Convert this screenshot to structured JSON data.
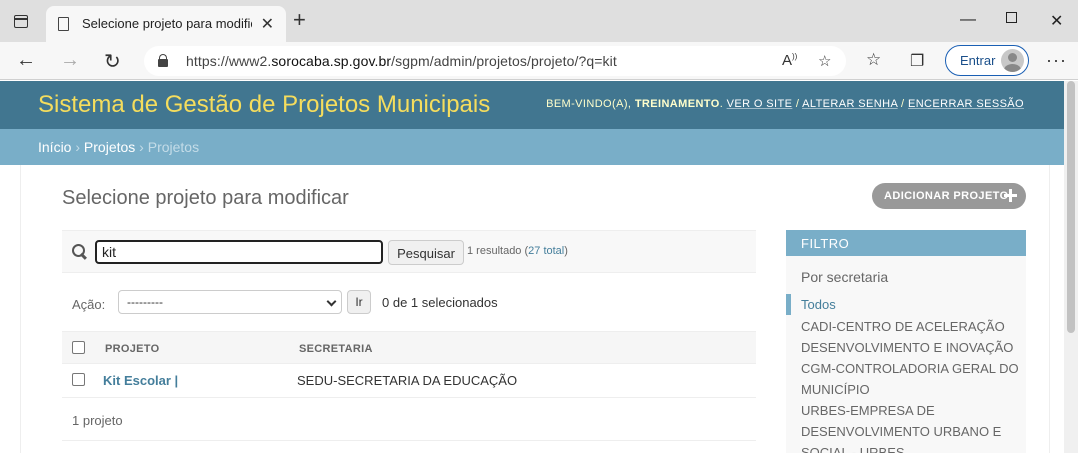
{
  "browser": {
    "tab_title": "Selecione projeto para modificar",
    "url_prefix": "https://www2.",
    "url_host": "sorocaba.sp.gov.br",
    "url_path": "/sgpm/admin/projetos/projeto/?q=kit",
    "signin_label": "Entrar"
  },
  "header": {
    "site_name": "Sistema de Gestão de Projetos Municipais",
    "welcome": "Bem-vindo(a),",
    "username": "TREINAMENTO",
    "links": [
      "Ver o site",
      "Alterar senha",
      "Encerrar sessão"
    ]
  },
  "breadcrumbs": {
    "home": "Início",
    "app": "Projetos",
    "current": "Projetos",
    "separator": "›"
  },
  "main": {
    "title": "Selecione projeto para modificar",
    "add_button": "ADICIONAR PROJETO",
    "search": {
      "value": "kit",
      "button": "Pesquisar",
      "result_count": "1 resultado (",
      "total_link": "27 total",
      "result_close": ")"
    },
    "actions": {
      "label": "Ação:",
      "selected_option": "---------",
      "go_button": "Ir",
      "counter": "0 de 1 selecionados"
    },
    "table": {
      "headers": [
        "PROJETO",
        "SECRETARIA"
      ],
      "rows": [
        {
          "projeto": "Kit Escolar |",
          "secretaria": "SEDU-SECRETARIA DA EDUCAÇÃO"
        }
      ]
    },
    "paginator": "1 projeto"
  },
  "filter": {
    "title": "FILTRO",
    "subtitle": "Por secretaria",
    "items": [
      {
        "label": "Todos",
        "selected": true
      },
      {
        "label": "CADI-CENTRO DE ACELERAÇÃO DESENVOLVIMENTO E INOVAÇÃO",
        "selected": false
      },
      {
        "label": "CGM-CONTROLADORIA GERAL DO MUNICÍPIO",
        "selected": false
      },
      {
        "label": "URBES-EMPRESA DE DESENVOLVIMENTO URBANO E SOCIAL - URBES",
        "selected": false
      }
    ]
  },
  "colors": {
    "header_bg": "#417690",
    "breadcrumb_bg": "#79aec8",
    "brand_yellow": "#f5dd5d",
    "link": "#447e9b"
  }
}
